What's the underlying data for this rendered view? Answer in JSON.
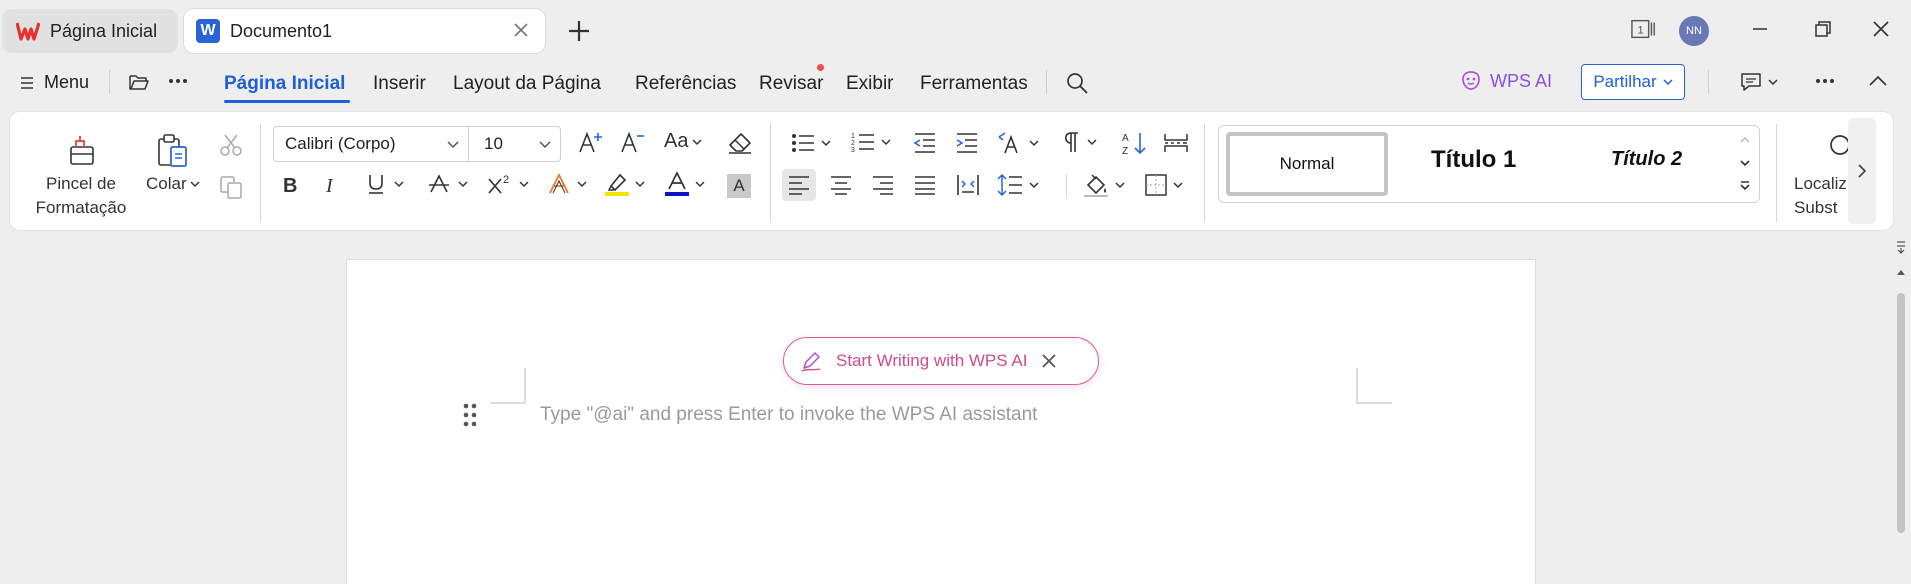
{
  "tabs": [
    {
      "label": "Página Inicial"
    },
    {
      "label": "Documento1",
      "logo": "W"
    }
  ],
  "window": {
    "avatar_initials": "NN"
  },
  "menubar": {
    "menu_label": "Menu",
    "items": [
      "Página Inicial",
      "Inserir",
      "Layout da Página",
      "Referências",
      "Revisar",
      "Exibir",
      "Ferramentas"
    ],
    "active": "Página Inicial",
    "wps_ai_label": "WPS AI",
    "share_label": "Partilhar"
  },
  "ribbon": {
    "format_painter_label_1": "Pincel de",
    "format_painter_label_2": "Formatação",
    "paste_label": "Colar",
    "font_name": "Calibri (Corpo)",
    "font_size": "10",
    "change_case_label": "Aa",
    "highlight_color": "#f5e400",
    "font_color": "#1212c8",
    "char_shading_label": "A",
    "styles": {
      "normal": "Normal",
      "heading1": "Título 1",
      "heading2": "Título 2"
    },
    "find_label_1": "Localiz",
    "find_label_2": "Subst"
  },
  "document": {
    "ai_prompt_label": "Start Writing with WPS AI",
    "placeholder": "Type \"@ai\" and press Enter to invoke the WPS AI assistant"
  },
  "colors": {
    "accent": "#1f5fd8",
    "ai_pink": "#d24a8a",
    "notification": "#ef4e4e"
  }
}
